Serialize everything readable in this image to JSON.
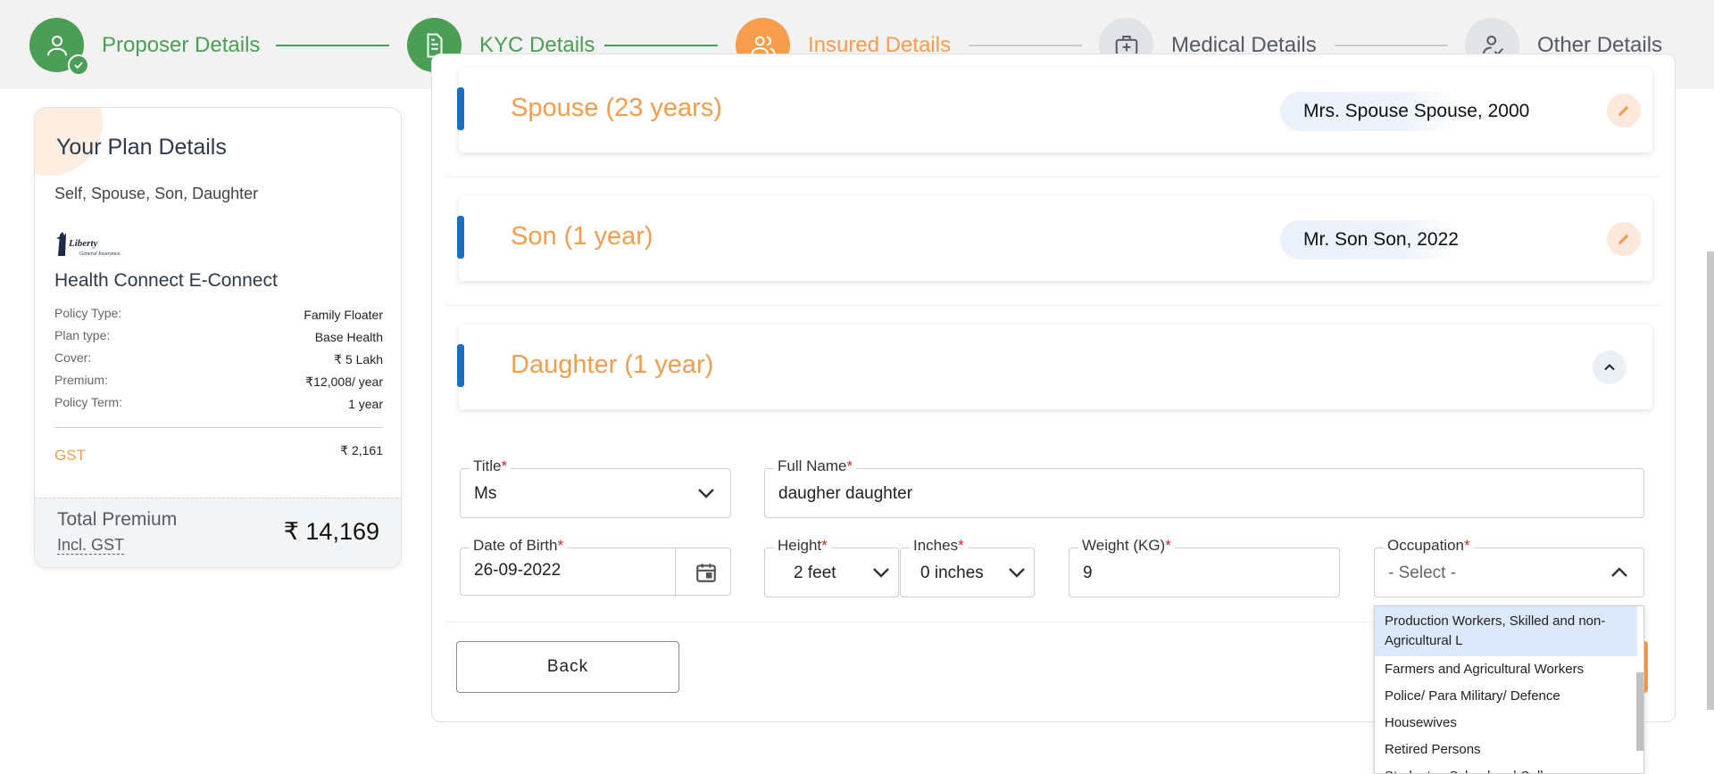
{
  "stepper": {
    "steps": [
      {
        "label": "Proposer Details",
        "status": "done",
        "icon": "user-icon"
      },
      {
        "label": "KYC Details",
        "status": "done",
        "icon": "document-icon"
      },
      {
        "label": "Insured Details",
        "status": "active",
        "icon": "users-icon"
      },
      {
        "label": "Medical Details",
        "status": "pending",
        "icon": "medical-kit-icon"
      },
      {
        "label": "Other Details",
        "status": "pending",
        "icon": "user-check-icon"
      }
    ]
  },
  "plan": {
    "title": "Your Plan Details",
    "members": "Self, Spouse, Son, Daughter",
    "insurer_logo_text": "Liberty General Insurance",
    "plan_name": "Health Connect E-Connect",
    "rows": [
      {
        "label": "Policy Type:",
        "value": "Family Floater"
      },
      {
        "label": "Plan type:",
        "value": "Base Health"
      },
      {
        "label": "Cover:",
        "value": "₹ 5 Lakh"
      },
      {
        "label": "Premium:",
        "value": "₹12,008/ year"
      },
      {
        "label": "Policy Term:",
        "value": "1 year"
      }
    ],
    "gst_label": "GST",
    "gst_value": "₹ 2,161",
    "total_label": "Total Premium",
    "total_incl": "Incl. GST",
    "total_value": "₹ 14,169"
  },
  "members": {
    "spouse": {
      "title": "Spouse (23 years)",
      "summary": "Mrs. Spouse Spouse, 2000"
    },
    "son": {
      "title": "Son (1 year)",
      "summary": "Mr. Son Son, 2022"
    },
    "daughter": {
      "title": "Daughter (1 year)"
    }
  },
  "form": {
    "title_label": "Title",
    "title_value": "Ms",
    "fullname_label": "Full Name",
    "fullname_value": "daugher daughter",
    "dob_label": "Date of Birth",
    "dob_value": "26-09-2022",
    "height_label": "Height",
    "height_value": "2 feet",
    "inches_label": "Inches",
    "inches_value": "0 inches",
    "weight_label": "Weight (KG)",
    "weight_value": "9",
    "occupation_label": "Occupation",
    "occupation_value": "- Select -",
    "required_mark": "*"
  },
  "occupation_options": [
    "Production Workers, Skilled and non-Agricultural L",
    "Farmers and Agricultural Workers",
    "Police/ Para Military/ Defence",
    "Housewives",
    "Retired Persons",
    "Students - School and College"
  ],
  "actions": {
    "back_label": "Back"
  },
  "colors": {
    "green": "#4a9e55",
    "orange": "#f59d4c",
    "blue_accent": "#1a6fc1",
    "grey": "#e2e3e7"
  }
}
